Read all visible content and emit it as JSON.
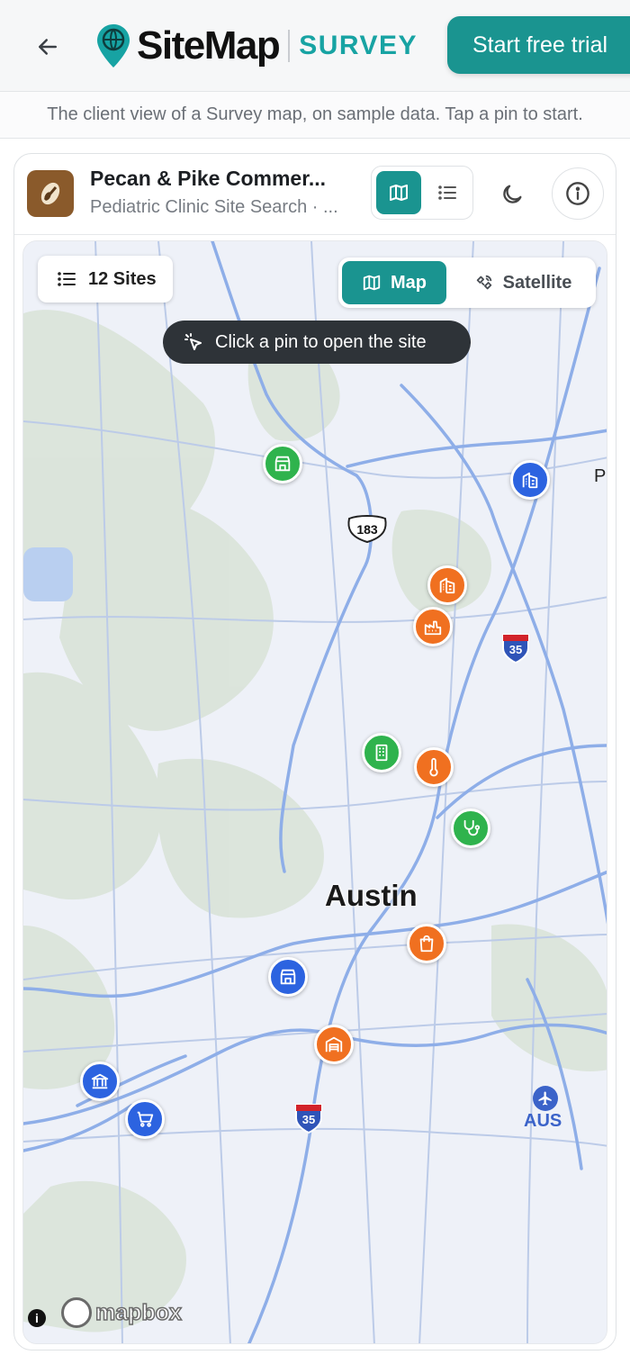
{
  "header": {
    "brand_name": "SiteMap",
    "brand_product": "SURVEY",
    "trial_button": "Start free trial"
  },
  "subtitle": "The client view of a Survey map, on sample data. Tap a pin to start.",
  "project": {
    "title": "Pecan & Pike Commer...",
    "subtitle": "Pediatric Clinic Site Search · ..."
  },
  "map": {
    "sites_count_label": "12 Sites",
    "toggle_map": "Map",
    "toggle_satellite": "Satellite",
    "hint": "Click a pin to open the site",
    "city_label": "Austin",
    "airport_label": "AUS",
    "highway_183": "183",
    "interstate_35": "35",
    "attribution": "mapbox",
    "edge_label": "P",
    "pins": [
      {
        "icon": "storefront-icon",
        "color": "green"
      },
      {
        "icon": "office-building-icon",
        "color": "blue"
      },
      {
        "icon": "office-building-icon",
        "color": "orange"
      },
      {
        "icon": "factory-icon",
        "color": "orange"
      },
      {
        "icon": "building-icon",
        "color": "green"
      },
      {
        "icon": "thermometer-icon",
        "color": "orange"
      },
      {
        "icon": "stethoscope-icon",
        "color": "green"
      },
      {
        "icon": "shopping-bag-icon",
        "color": "orange"
      },
      {
        "icon": "storefront-icon",
        "color": "blue"
      },
      {
        "icon": "warehouse-icon",
        "color": "orange"
      },
      {
        "icon": "bank-icon",
        "color": "blue"
      },
      {
        "icon": "cart-icon",
        "color": "blue"
      }
    ]
  },
  "colors": {
    "accent": "#1a9490",
    "pin_green": "#2fb34d",
    "pin_blue": "#2c63e0",
    "pin_orange": "#f07020"
  }
}
